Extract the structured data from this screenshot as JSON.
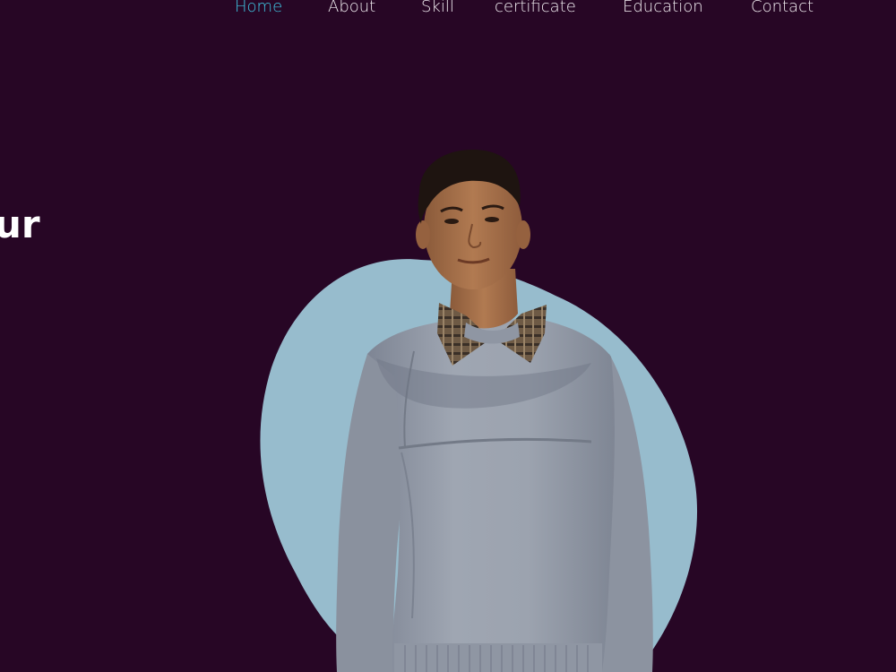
{
  "nav": {
    "items": [
      {
        "label": "Home",
        "active": true
      },
      {
        "label": "About",
        "active": false
      },
      {
        "label": "Skill",
        "active": false
      },
      {
        "label": "certificate",
        "active": false
      },
      {
        "label": "Education",
        "active": false
      },
      {
        "label": "Contact",
        "active": false
      }
    ]
  },
  "hero": {
    "heading_visible_fragment": "ur"
  },
  "colors": {
    "background": "#270625",
    "nav_text": "#f2eef2",
    "nav_active": "#3fc6e3",
    "blob": "#97bccd",
    "heading": "#ffffff"
  },
  "icons": {
    "portrait": "person-photo"
  }
}
